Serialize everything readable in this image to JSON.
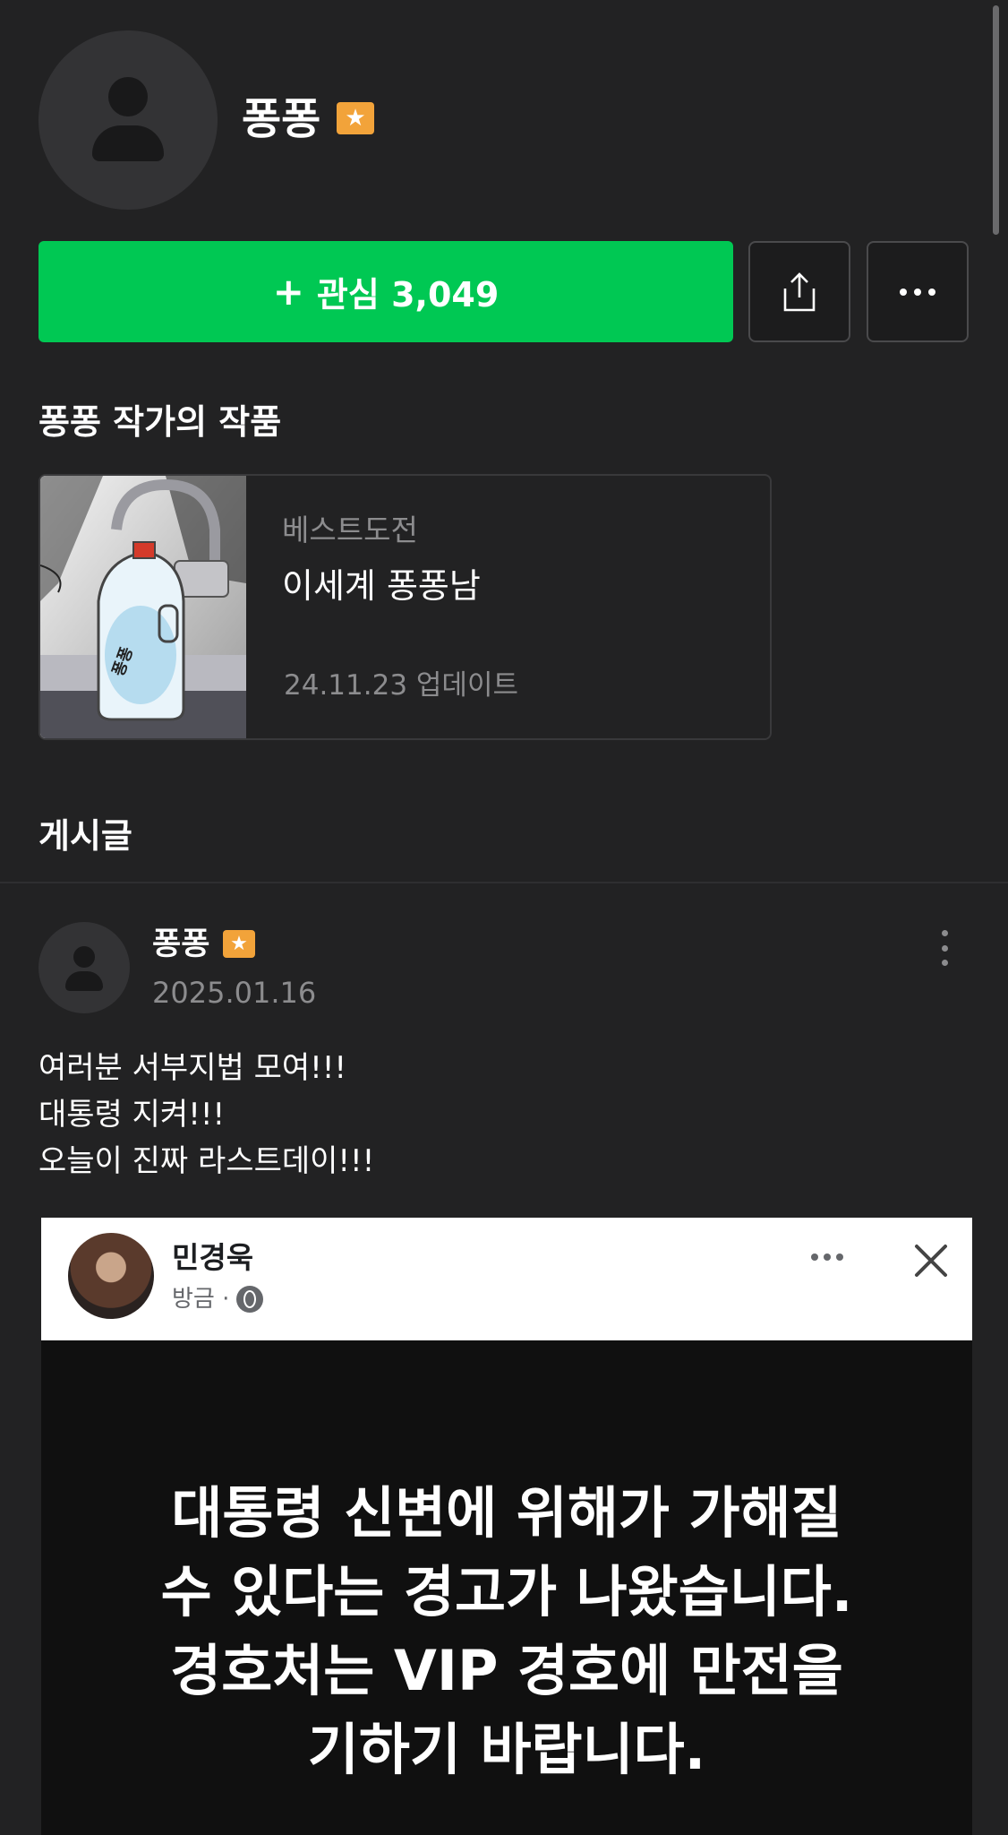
{
  "profile": {
    "name": "퐁퐁",
    "badge": "★"
  },
  "actions": {
    "follow_plus": "+",
    "follow_label": "관심 3,049",
    "share_icon": "share-icon",
    "more_icon": "more-horizontal-icon"
  },
  "works": {
    "section_title": "퐁퐁 작가의 작품",
    "items": [
      {
        "category": "베스트도전",
        "title": "이세계 퐁퐁남",
        "updated": "24.11.23 업데이트",
        "thumb_label": "퐁퐁"
      }
    ]
  },
  "posts": {
    "section_title": "게시글",
    "items": [
      {
        "author": "퐁퐁",
        "badge": "★",
        "date": "2025.01.16",
        "lines": [
          "여러분 서부지법 모여!!!",
          "대통령 지켜!!!",
          "오늘이 진짜 라스트데이!!!"
        ],
        "embed": {
          "name": "민경욱",
          "time": "방금 ·",
          "lines": [
            "대통령 신변에 위해가 가해질",
            "수 있다는 경고가 나왔습니다.",
            "경호처는 VIP 경호에 만전을",
            "기하기 바랍니다."
          ]
        }
      }
    ]
  },
  "colors": {
    "background": "#222223",
    "accent_green": "#00c853",
    "badge_orange": "#f2a33a",
    "muted_text": "#8c8c8e"
  }
}
